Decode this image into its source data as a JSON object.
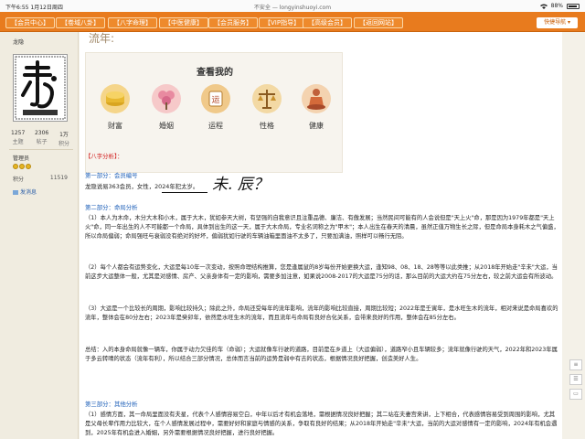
{
  "status": {
    "time": "下午6:55",
    "date": "1月12日周四",
    "url": "不安全 — longyinshuoyi.com",
    "battery": "88%"
  },
  "nav": {
    "tabs": [
      "【会员中心】",
      "【卷域八卦】",
      "【八字命理】",
      "【中医健康】",
      "【会员服务】",
      "【VIP指导】",
      "【高级会员】",
      "【返回网站】"
    ],
    "quick": "快捷导航"
  },
  "sidebar": {
    "username": "龙隐",
    "stats": [
      {
        "v": "1257",
        "l": "主题"
      },
      {
        "v": "2306",
        "l": "帖子"
      },
      {
        "v": "1万",
        "l": "积分"
      }
    ],
    "role": "管理员",
    "points_label": "积分",
    "points_value": "11519",
    "message": "发消息"
  },
  "main": {
    "page_head": "流年:",
    "view_title": "查看我的",
    "view_items": [
      "财富",
      "婚姻",
      "运程",
      "性格",
      "健康"
    ],
    "section_title": "【八字分析】：",
    "part1_title": "第一部分：会员编号",
    "part1_text": "龙隐说易363会员，女性，2024年犯太岁。",
    "handwriting": "未. 辰？",
    "part2_title": "第二部分：命局分析",
    "p1": "（1）本人为木命，木分大木和小木，属于大木，犹如参天大树，有坚强的自我意识且注重品德、廉洁、有傲发展；当然民间可能有的人会说但是\"天上火\"命，那是因为1979年都是\"天上火\"命，同一年出生的人不可能都一个命局，具体到出生的这一天，属于大木命局，专业名词称之为\"甲木\"；本人出生在春天的清晨，虽然正值万物生长之际，但是命局本身耗木之气偏盛，所以命局偏弱；命局强旺与衰弱没有绝对的好坏，偏弱犹如行驶的车辆油箱里面油不太多了，只要加满油，照样可以畅行无阻。",
    "p2": "（2）每个人都会有运势变化，大运是每10年一次变动，按照命理结构推算，您是逢属鼠的8岁每份开始更换大运，逢知98、08、18、28等等以此类推；从2018年开始走\"辛未\"大运，当前这步大运整体一般，尤其是对感情、房产、父亲身体有一定的影响，需要多加注意，如果说2008-2017的大运是75分的话，那么目前的大运大约在75分左右，较之前大运会有所波动。",
    "p3": "（3）大运是一个比较长的周期，影响比较持久；除此之外，命局还受每年的流年影响，流年的影响比较直接，周期比较短；2022年是壬寅年，是水旺生木的流年，相对来说是命局喜欢的流年，整体会在80分左右；2023年是癸卯年，依然是水旺生木的流年，而且流年与命局有良好合化关系，会带来良好的作用，整体会在85分左右。",
    "summary": "总结：入的本身命局就像一辆车，你属于动力欠佳的车（命弱）；大运就像车行驶的道路，目前是在乡道上（大运偏弱），道路窄小且车辆较多；流年就像行驶的天气，2022年和2023年属于多云转晴的状态（流年有利），所以结合三部分情况，总体而言当前的运势是弱中有吉的状态，根据情况良好把握，创造美好人生。",
    "part3_title": "第三部分：其他分析",
    "p4": "（1）感情方面，其一命局里面没有夫星，代表个人感情容易空白，中年以后才有机会落地，需根据情况良好把握；其二站在夫妻宫来讲，上下相合，代表感情容易受到周围的影响，尤其是父母长辈作用力比较大，在个人感情发展过程中，需要好好和家庭与情感的关系，争取有良好的结果；从2018年开始走\"辛未\"大运，当前的大运对感情有一定的影响，2024年有机会遇到，2025年有机会进入婚姻，另外需要根据情况良好把握，进行良好把握。"
  },
  "colors": {
    "nav": "#e87b1e",
    "accent_red": "#d21f1f",
    "link_blue": "#1d5fb8"
  },
  "icons": [
    "coins-icon",
    "flower-icon",
    "fortune-icon",
    "scales-icon",
    "meditation-icon",
    "comment-icon",
    "share-icon"
  ]
}
